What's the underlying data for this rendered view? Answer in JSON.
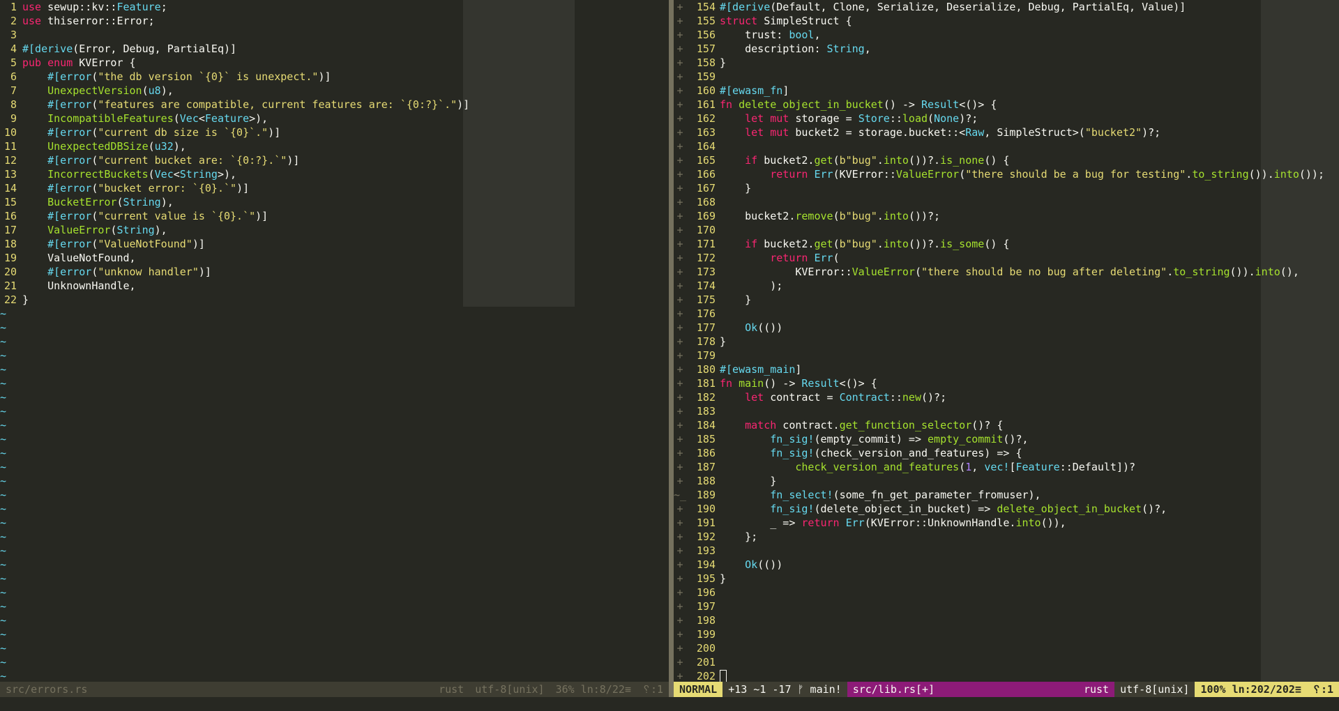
{
  "left": {
    "lines": [
      {
        "n": "1",
        "t": "use sewup::kv::Feature;"
      },
      {
        "n": "2",
        "t": "use thiserror::Error;"
      },
      {
        "n": "3",
        "t": ""
      },
      {
        "n": "4",
        "t": "#[derive(Error, Debug, PartialEq)]"
      },
      {
        "n": "5",
        "t": "pub enum KVError {"
      },
      {
        "n": "6",
        "t": "    #[error(\"the db version `{0}` is unexpect.\")]"
      },
      {
        "n": "7",
        "t": "    UnexpectVersion(u8),"
      },
      {
        "n": "8",
        "t": "    #[error(\"features are compatible, current features are: `{0:?}`.\")]"
      },
      {
        "n": "9",
        "t": "    IncompatibleFeatures(Vec<Feature>),"
      },
      {
        "n": "10",
        "t": "    #[error(\"current db size is `{0}`.\")]"
      },
      {
        "n": "11",
        "t": "    UnexpectedDBSize(u32),"
      },
      {
        "n": "12",
        "t": "    #[error(\"current bucket are: `{0:?}.`\")]"
      },
      {
        "n": "13",
        "t": "    IncorrectBuckets(Vec<String>),"
      },
      {
        "n": "14",
        "t": "    #[error(\"bucket error: `{0}.`\")]"
      },
      {
        "n": "15",
        "t": "    BucketError(String),"
      },
      {
        "n": "16",
        "t": "    #[error(\"current value is `{0}.`\")]"
      },
      {
        "n": "17",
        "t": "    ValueError(String),"
      },
      {
        "n": "18",
        "t": "    #[error(\"ValueNotFound\")]"
      },
      {
        "n": "19",
        "t": "    ValueNotFound,"
      },
      {
        "n": "20",
        "t": "    #[error(\"unknow handler\")]"
      },
      {
        "n": "21",
        "t": "    UnknownHandle,"
      },
      {
        "n": "22",
        "t": "}"
      }
    ],
    "tilde": "~",
    "status": {
      "file": "src/errors.rs",
      "filetype": "rust",
      "encoding": "utf-8[unix]",
      "position": "36% ln:8/22≡",
      "col": "␦:1"
    }
  },
  "right": {
    "lines": [
      {
        "g": "+",
        "n": "154",
        "t": "#[derive(Default, Clone, Serialize, Deserialize, Debug, PartialEq, Value)]"
      },
      {
        "g": "+",
        "n": "155",
        "t": "struct SimpleStruct {"
      },
      {
        "g": "+",
        "n": "156",
        "t": "    trust: bool,"
      },
      {
        "g": "+",
        "n": "157",
        "t": "    description: String,"
      },
      {
        "g": "+",
        "n": "158",
        "t": "}"
      },
      {
        "g": "+",
        "n": "159",
        "t": ""
      },
      {
        "g": "+",
        "n": "160",
        "t": "#[ewasm_fn]"
      },
      {
        "g": "+",
        "n": "161",
        "t": "fn delete_object_in_bucket() -> Result<()> {"
      },
      {
        "g": "+",
        "n": "162",
        "t": "    let mut storage = Store::load(None)?;"
      },
      {
        "g": "+",
        "n": "163",
        "t": "    let mut bucket2 = storage.bucket::<Raw, SimpleStruct>(\"bucket2\")?;"
      },
      {
        "g": "+",
        "n": "164",
        "t": ""
      },
      {
        "g": "+",
        "n": "165",
        "t": "    if bucket2.get(b\"bug\".into())?.is_none() {"
      },
      {
        "g": "+",
        "n": "166",
        "t": "        return Err(KVError::ValueError(\"there should be a bug for testing\".to_string()).into());"
      },
      {
        "g": "+",
        "n": "167",
        "t": "    }"
      },
      {
        "g": "+",
        "n": "168",
        "t": ""
      },
      {
        "g": "+",
        "n": "169",
        "t": "    bucket2.remove(b\"bug\".into())?;"
      },
      {
        "g": "+",
        "n": "170",
        "t": ""
      },
      {
        "g": "+",
        "n": "171",
        "t": "    if bucket2.get(b\"bug\".into())?.is_some() {"
      },
      {
        "g": "+",
        "n": "172",
        "t": "        return Err("
      },
      {
        "g": "+",
        "n": "173",
        "t": "            KVError::ValueError(\"there should be no bug after deleting\".to_string()).into(),"
      },
      {
        "g": "+",
        "n": "174",
        "t": "        );"
      },
      {
        "g": "+",
        "n": "175",
        "t": "    }"
      },
      {
        "g": "+",
        "n": "176",
        "t": ""
      },
      {
        "g": "+",
        "n": "177",
        "t": "    Ok(())"
      },
      {
        "g": "+",
        "n": "178",
        "t": "}"
      },
      {
        "g": "+",
        "n": "179",
        "t": ""
      },
      {
        "g": "+",
        "n": "180",
        "t": "#[ewasm_main]"
      },
      {
        "g": "+",
        "n": "181",
        "t": "fn main() -> Result<()> {"
      },
      {
        "g": "+",
        "n": "182",
        "t": "    let contract = Contract::new()?;"
      },
      {
        "g": "+",
        "n": "183",
        "t": ""
      },
      {
        "g": "+",
        "n": "184",
        "t": "    match contract.get_function_selector()? {"
      },
      {
        "g": "+",
        "n": "185",
        "t": "        fn_sig!(empty_commit) => empty_commit()?,"
      },
      {
        "g": "+",
        "n": "186",
        "t": "        fn_sig!(check_version_and_features) => {"
      },
      {
        "g": "+",
        "n": "187",
        "t": "            check_version_and_features(1, vec![Feature::Default])?"
      },
      {
        "g": "+",
        "n": "188",
        "t": "        }"
      },
      {
        "g": "~_",
        "n": "189",
        "t": "        fn_select!(some_fn_get_parameter_fromuser),"
      },
      {
        "g": "+",
        "n": "190",
        "t": "        fn_sig!(delete_object_in_bucket) => delete_object_in_bucket()?,"
      },
      {
        "g": "+",
        "n": "191",
        "t": "        _ => return Err(KVError::UnknownHandle.into()),"
      },
      {
        "g": "+",
        "n": "192",
        "t": "    };"
      },
      {
        "g": "+",
        "n": "193",
        "t": ""
      },
      {
        "g": "+",
        "n": "194",
        "t": "    Ok(())"
      },
      {
        "g": "+",
        "n": "195",
        "t": "}"
      },
      {
        "g": "+",
        "n": "196",
        "t": ""
      },
      {
        "g": "+",
        "n": "197",
        "t": ""
      },
      {
        "g": "+",
        "n": "198",
        "t": ""
      },
      {
        "g": "+",
        "n": "199",
        "t": ""
      },
      {
        "g": "+",
        "n": "200",
        "t": ""
      },
      {
        "g": "+",
        "n": "201",
        "t": ""
      },
      {
        "g": "+",
        "n": "202",
        "t": ""
      }
    ],
    "status": {
      "mode": "NORMAL",
      "git": "+13 ~1 -17 ᚠ main!",
      "file": "src/lib.rs[+]",
      "filetype": "rust",
      "encoding": "utf-8[unix]",
      "position": "100% ln:202/202≡",
      "col": "␦:1"
    }
  },
  "colors": {
    "background": "#272822",
    "keyword": "#f92672",
    "type": "#66d9ef",
    "function": "#a6e22e",
    "string": "#e6db74",
    "line_number": "#e6db74",
    "mode_bg": "#e6db74",
    "file_bg": "#8d1b78"
  }
}
